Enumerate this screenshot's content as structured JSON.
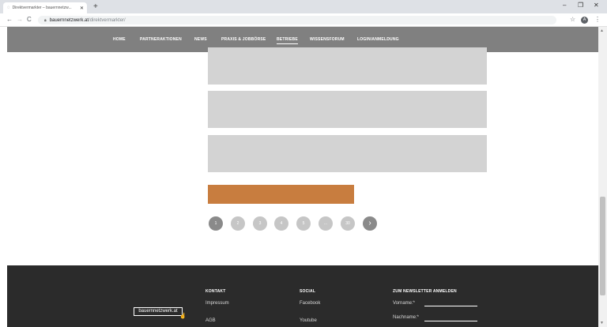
{
  "browser": {
    "tab_title": "Direktvermarkter – bauernnetzw...",
    "new_tab": "+",
    "url_host": "bauernnetzwerk.at",
    "url_path": "/direktvermarkter/",
    "avatar_letter": "A"
  },
  "nav": {
    "items": [
      {
        "label": "HOME"
      },
      {
        "label": "PARTNERAKTIONEN"
      },
      {
        "label": "NEWS"
      },
      {
        "label": "PRAXIS & JOBBÖRSE"
      },
      {
        "label": "BETRIEBE"
      },
      {
        "label": "WISSENSFORUM"
      },
      {
        "label": "LOGIN/ANMELDUNG"
      }
    ],
    "active": "BETRIEBE"
  },
  "pagination": {
    "pages": [
      "1",
      "2",
      "3",
      "4",
      "5",
      "...",
      "30"
    ],
    "current": "1",
    "next_label": "›"
  },
  "colors": {
    "nav_bg": "#808080",
    "card_bg": "#d3d3d3",
    "cta_bg": "#c87d3f",
    "pager_active": "#8a8a8a",
    "pager_inactive": "#c6c6c6",
    "footer_bg": "#2b2b2b"
  },
  "footer": {
    "logo": "bauernnetzwerk.at",
    "kontakt_title": "KONTAKT",
    "kontakt_links": [
      "Impressum",
      "AGB"
    ],
    "social_title": "SOCIAL",
    "social_links": [
      "Facebook",
      "Youtube"
    ],
    "newsletter_title": "ZUM NEWSLETTER ANMELDEN",
    "newsletter_fields": [
      "Vorname:*",
      "Nachname:*"
    ]
  }
}
